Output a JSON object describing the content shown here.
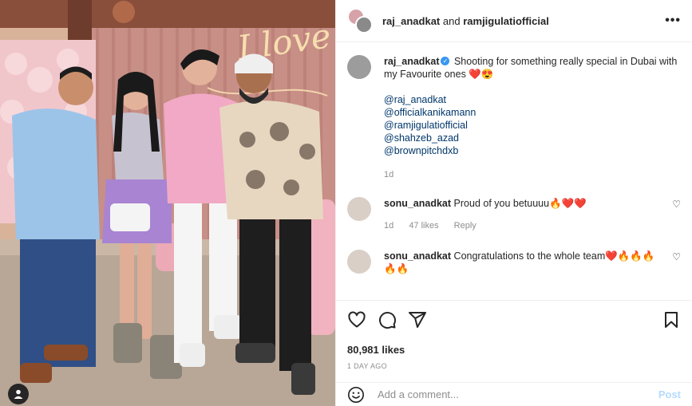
{
  "header": {
    "user1": "raj_anadkat",
    "and": "and",
    "user2": "ramjigulatiofficial",
    "more": "•••"
  },
  "caption": {
    "user": "raj_anadkat",
    "text": "Shooting for something really special in Dubai with my Favourite ones ❤️😍",
    "mentions": [
      "@raj_anadkat",
      "@officialkanikamann",
      "@ramjigulatiofficial",
      "@shahzeb_azad",
      "@brownpitchdxb"
    ],
    "time": "1d"
  },
  "comments": [
    {
      "user": "sonu_anadkat",
      "text": "Proud of you betuuuu🔥❤️❤️",
      "time": "1d",
      "likes": "47 likes",
      "reply": "Reply"
    },
    {
      "user": "sonu_anadkat",
      "text": "Congratulations to the whole team❤️🔥🔥🔥🔥🔥"
    }
  ],
  "post": {
    "likes": "80,981 likes",
    "date": "1 DAY AGO"
  },
  "comment_input": {
    "placeholder": "Add a comment...",
    "post_label": "Post"
  },
  "photo": {
    "neon_text": "I love"
  },
  "icons": {
    "like": "heart-icon",
    "comment": "comment-icon",
    "share": "share-icon",
    "save": "bookmark-icon",
    "emoji": "emoji-icon",
    "user_tag": "user-tag-icon"
  },
  "colors": {
    "link": "#00376b",
    "verified": "#3897f0",
    "post_button": "#b3dbff",
    "muted": "#8e8e8e"
  }
}
